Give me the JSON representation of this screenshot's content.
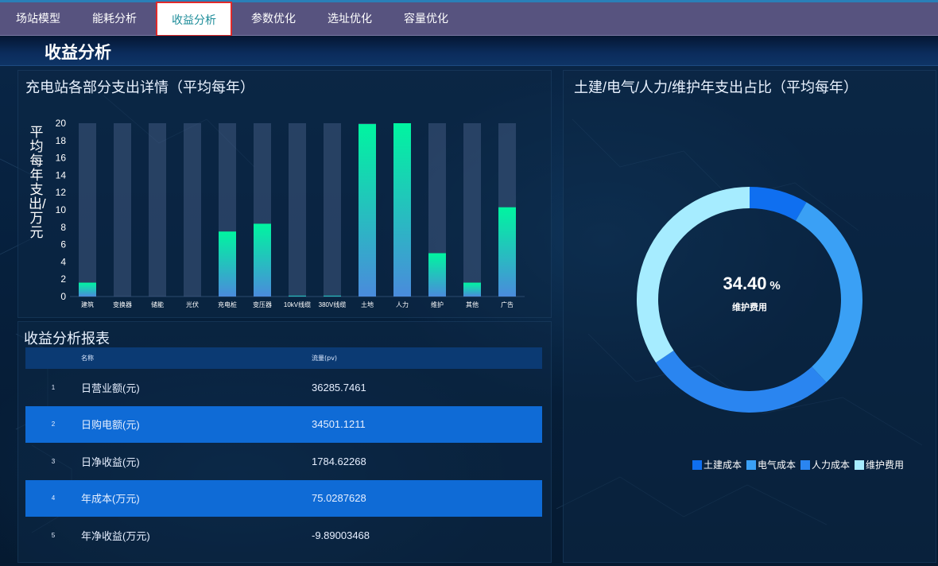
{
  "nav": {
    "tabs": [
      {
        "label": "场站模型"
      },
      {
        "label": "能耗分析"
      },
      {
        "label": "收益分析",
        "active": true
      },
      {
        "label": "参数优化"
      },
      {
        "label": "选址优化"
      },
      {
        "label": "容量优化"
      }
    ]
  },
  "page": {
    "title": "收益分析"
  },
  "bar_panel": {
    "title": "充电站各部分支出详情（平均每年）"
  },
  "table_panel": {
    "title": "收益分析报表",
    "columns": [
      "名称",
      "流量(pv)"
    ],
    "rows": [
      {
        "idx": "1",
        "name": "日营业额(元)",
        "value": "36285.7461"
      },
      {
        "idx": "2",
        "name": "日购电额(元)",
        "value": "34501.1211"
      },
      {
        "idx": "3",
        "name": "日净收益(元)",
        "value": "1784.62268"
      },
      {
        "idx": "4",
        "name": "年成本(万元)",
        "value": "75.0287628"
      },
      {
        "idx": "5",
        "name": "年净收益(万元)",
        "value": "-9.89003468"
      }
    ]
  },
  "donut_panel": {
    "title": "土建/电气/人力/维护年支出占比（平均每年）",
    "center_value": "34.40",
    "center_unit": "%",
    "center_label": "维护费用",
    "legend": [
      {
        "name": "土建成本",
        "color": "#0f6ff0"
      },
      {
        "name": "电气成本",
        "color": "#3aa0f5"
      },
      {
        "name": "人力成本",
        "color": "#2a85f0"
      },
      {
        "name": "维护费用",
        "color": "#a6ecff"
      }
    ]
  },
  "chart_data": [
    {
      "type": "bar",
      "title": "充电站各部分支出详情（平均每年）",
      "ylabel": "平均每年支出/万元",
      "xlabel": "",
      "ylim": [
        0,
        20
      ],
      "yticks": [
        0,
        2,
        4,
        6,
        8,
        10,
        12,
        14,
        16,
        18,
        20
      ],
      "categories": [
        "建筑",
        "变换器",
        "储能",
        "光伏",
        "充电桩",
        "变压器",
        "10kV线缆",
        "380V线缆",
        "土地",
        "人力",
        "维护",
        "其他",
        "广告"
      ],
      "values": [
        1.6,
        0,
        0,
        0,
        7.5,
        8.4,
        0.1,
        0.1,
        19.9,
        20.0,
        5.0,
        1.6,
        10.3
      ],
      "background_max": 20,
      "grid": false
    },
    {
      "type": "pie",
      "title": "土建/电气/人力/维护年支出占比（平均每年）",
      "donut": true,
      "series": [
        {
          "name": "土建成本",
          "value": 8.4
        },
        {
          "name": "电气成本",
          "value": 29.7
        },
        {
          "name": "人力成本",
          "value": 27.5
        },
        {
          "name": "维护费用",
          "value": 34.4
        }
      ],
      "colors": [
        "#0f6ff0",
        "#3aa0f5",
        "#2a85f0",
        "#a6ecff"
      ],
      "legend_position": "bottom-right"
    }
  ]
}
